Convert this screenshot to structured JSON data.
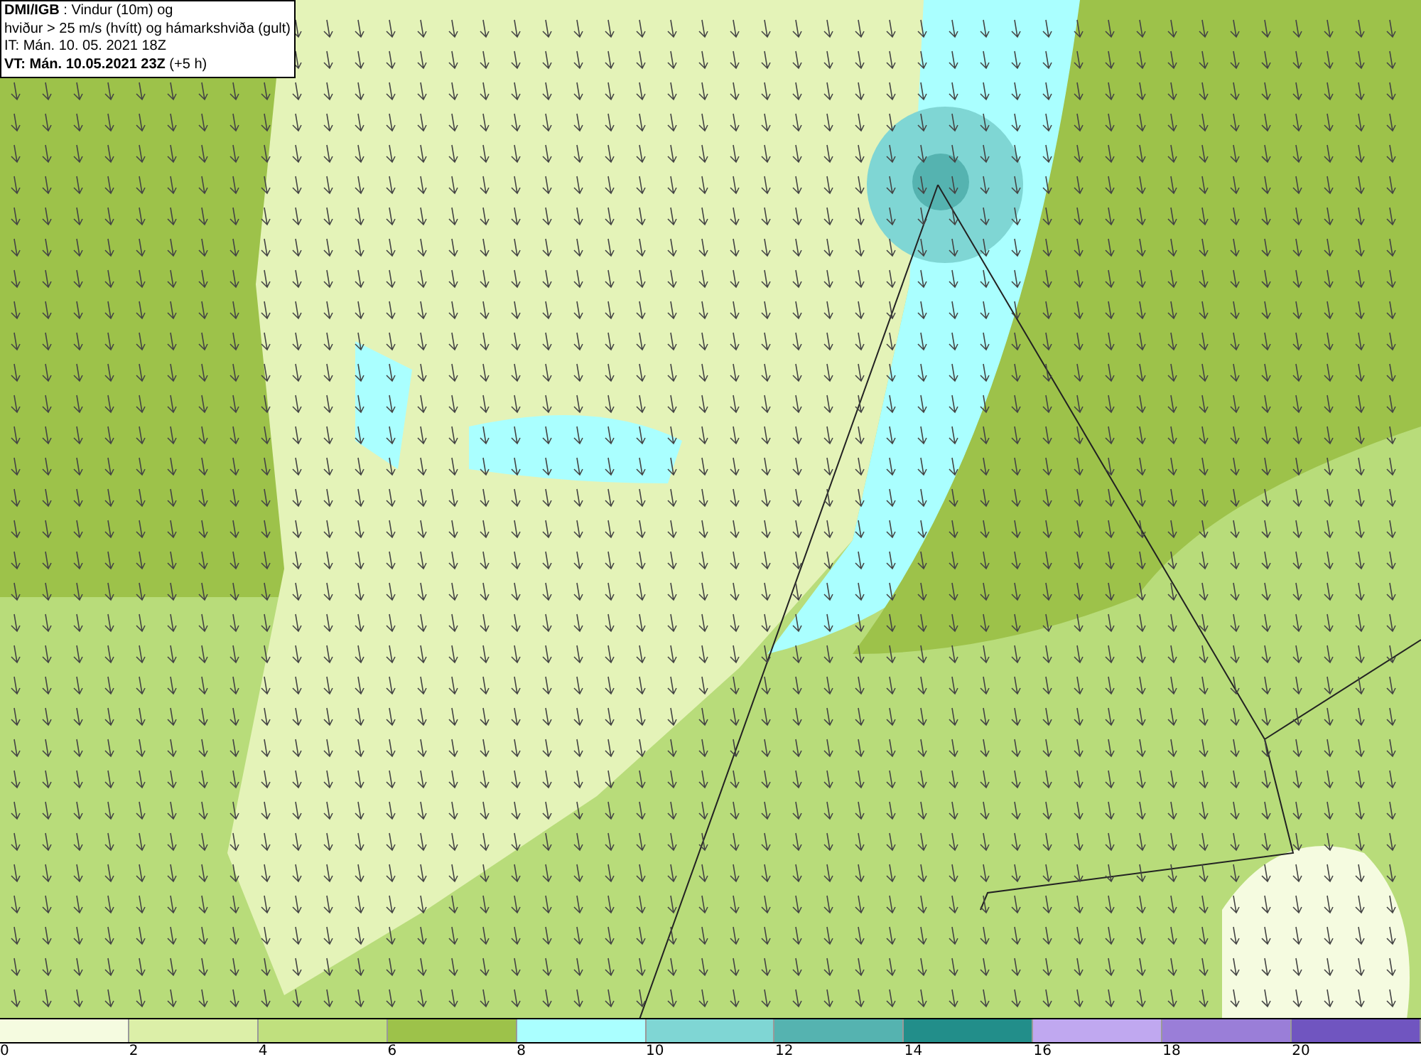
{
  "title_box": {
    "lines": [
      "**DMI/IGB** : Vindur (10m) og",
      "hviður > 25 m/s (hvítt) og hámarkshviða (gult)",
      "IT: Mán. 10. 05. 2021 18Z",
      "**VT: Mán. 10.05.2021 23Z** (+5 h)"
    ]
  },
  "legend": {
    "bins": [
      {
        "color": "#f5fbe0"
      },
      {
        "color": "#dcefa8"
      },
      {
        "color": "#c0e07e"
      },
      {
        "color": "#9dc24a"
      },
      {
        "color": "#aaffff"
      },
      {
        "color": "#7fd6d4"
      },
      {
        "color": "#55b3b0"
      },
      {
        "color": "#228e8a"
      },
      {
        "color": "#c0a8f0"
      },
      {
        "color": "#9a7ed8"
      },
      {
        "color": "#7055c0"
      }
    ],
    "labels": [
      "0",
      "2",
      "4",
      "6",
      "8",
      "10",
      "12",
      "14",
      "16",
      "18",
      "20"
    ]
  }
}
